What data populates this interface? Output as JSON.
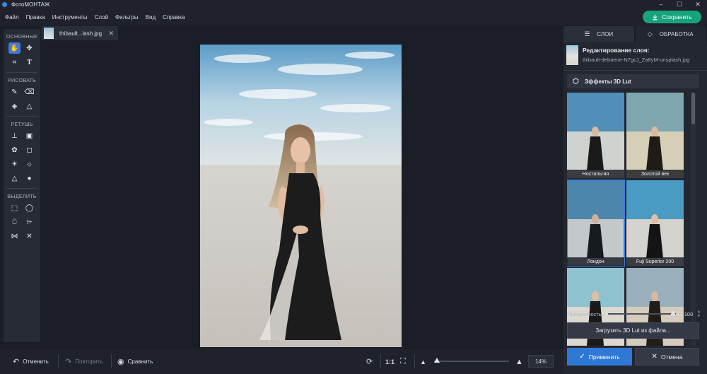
{
  "app": {
    "title": "ФотоМОНТАЖ"
  },
  "window": {
    "minimize": "–",
    "maximize": "☐",
    "close": "✕"
  },
  "menu": [
    "Файл",
    "Правка",
    "Инструменты",
    "Слой",
    "Фильтры",
    "Вид",
    "Справка"
  ],
  "save_button": "Сохранить",
  "tools": {
    "groups": [
      "ОСНОВНЫЕ",
      "РИСОВАТЬ",
      "РЕТУШЬ",
      "ВЫДЕЛИТЬ"
    ]
  },
  "document": {
    "tab_name": "thibault...lash.jpg",
    "close": "✕"
  },
  "bottom": {
    "undo": "Отменить",
    "redo": "Повторить",
    "compare": "Сравнить",
    "actual_size": "1:1",
    "zoom": "14%",
    "zoom_fraction": 0
  },
  "right_panel": {
    "tabs": [
      "СЛОИ",
      "ОБРАБОТКА"
    ],
    "edit_title": "Редактирование слоя:",
    "edit_file": "thibault-debaene-N7gcJ_Za8yM-unsplash.jpg",
    "effects_title": "Эффекты 3D Lut",
    "presets": [
      "Ностальгия",
      "Золотой век",
      "Лондон",
      "Fuji Superior 200"
    ],
    "selected_preset": "Лондон",
    "opacity_label": "Прозрачность",
    "opacity_value": "100",
    "load_button": "Загрузить 3D Lut из файла...",
    "apply_button": "Применить",
    "cancel_button": "Отмена"
  },
  "colors": {
    "accent_green": "#17a37b",
    "accent_blue": "#2f78d6",
    "panel_bg": "#232730",
    "canvas_bg": "#1b1e27"
  }
}
